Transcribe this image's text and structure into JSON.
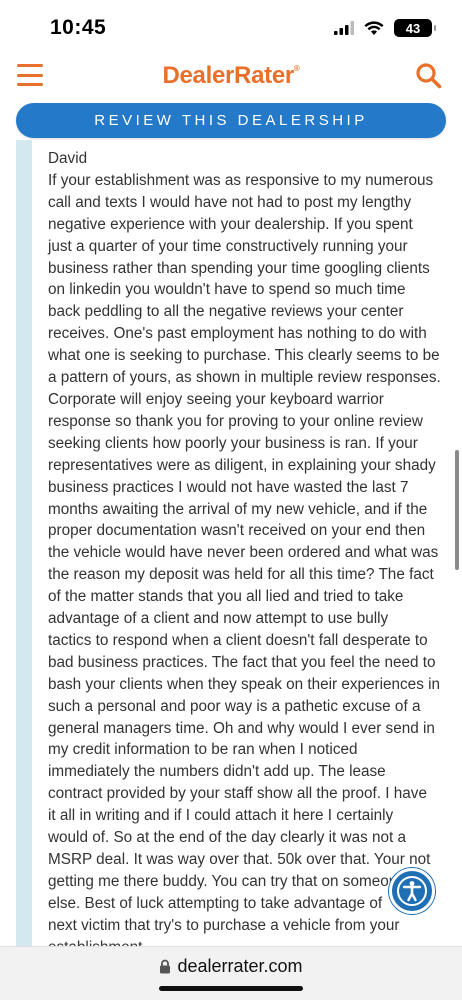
{
  "status_bar": {
    "time": "10:45",
    "battery": "43",
    "icons": [
      "signal-icon",
      "wifi-icon",
      "battery-icon"
    ]
  },
  "header": {
    "logo_text": "DealerRater",
    "logo_mark": "®",
    "menu_icon": "hamburger-menu-icon",
    "search_icon": "search-icon"
  },
  "review_button": {
    "label": "REVIEW THIS DEALERSHIP"
  },
  "review": {
    "author": "David",
    "text": "If your establishment was as responsive to my numerous\ncall and texts I would have not had to post my lengthy\nnegative experience with your dealership. If you spent\njust a quarter of your time constructively running your\nbusiness rather than spending your time googling clients\non linkedin you wouldn't have to spend so much time\nback peddling to all the negative reviews your center\nreceives. One's past employment has nothing to do with\nwhat one is seeking to purchase. This clearly seems to be\na pattern of yours, as shown in multiple review responses.\nCorporate will enjoy seeing your keyboard warrior\nresponse so thank you for proving to your online review\nseeking clients how poorly your business is ran.  If your\nrepresentatives were as diligent, in explaining your shady\nbusiness practices I would not have wasted the last 7\nmonths awaiting the arrival of my new vehicle, and if the\nproper documentation wasn't received on your end then\nthe vehicle would have never been ordered and what was\nthe reason my deposit was held for all this time? The fact\nof the matter stands that you all lied and tried to take\nadvantage of a client and now attempt to use bully\ntactics to respond when a client doesn't fall desperate to\nbad business practices. The fact that you feel the need to\nbash your clients when they speak on their experiences in\nsuch a personal and poor way is a pathetic excuse of a\ngeneral managers time.  Oh and why would I ever send in\nmy credit information to be ran when I noticed\nimmediately the numbers didn't add up. The lease\ncontract provided by your staff show all the proof. I have\nit all in writing and if I could attach it here I certainly\nwould of. So at the end of the day clearly it was not a\nMSRP deal.  It was way over that. 50k over that.  Your not\ngetting me there buddy. You can try that on someone\nelse.  Best of luck attempting to take advantage of\nnext victim that try's to purchase a vehicle from your\nestablishment."
  },
  "accessibility": {
    "icon": "accessibility-icon"
  },
  "url_bar": {
    "url": "dealerrater.com",
    "icon": "lock-icon"
  },
  "colors": {
    "brand_orange": "#e8702a",
    "button_blue": "#2479c9",
    "rail": "#d4e9ef",
    "a11y_blue": "#1f6fb5"
  }
}
